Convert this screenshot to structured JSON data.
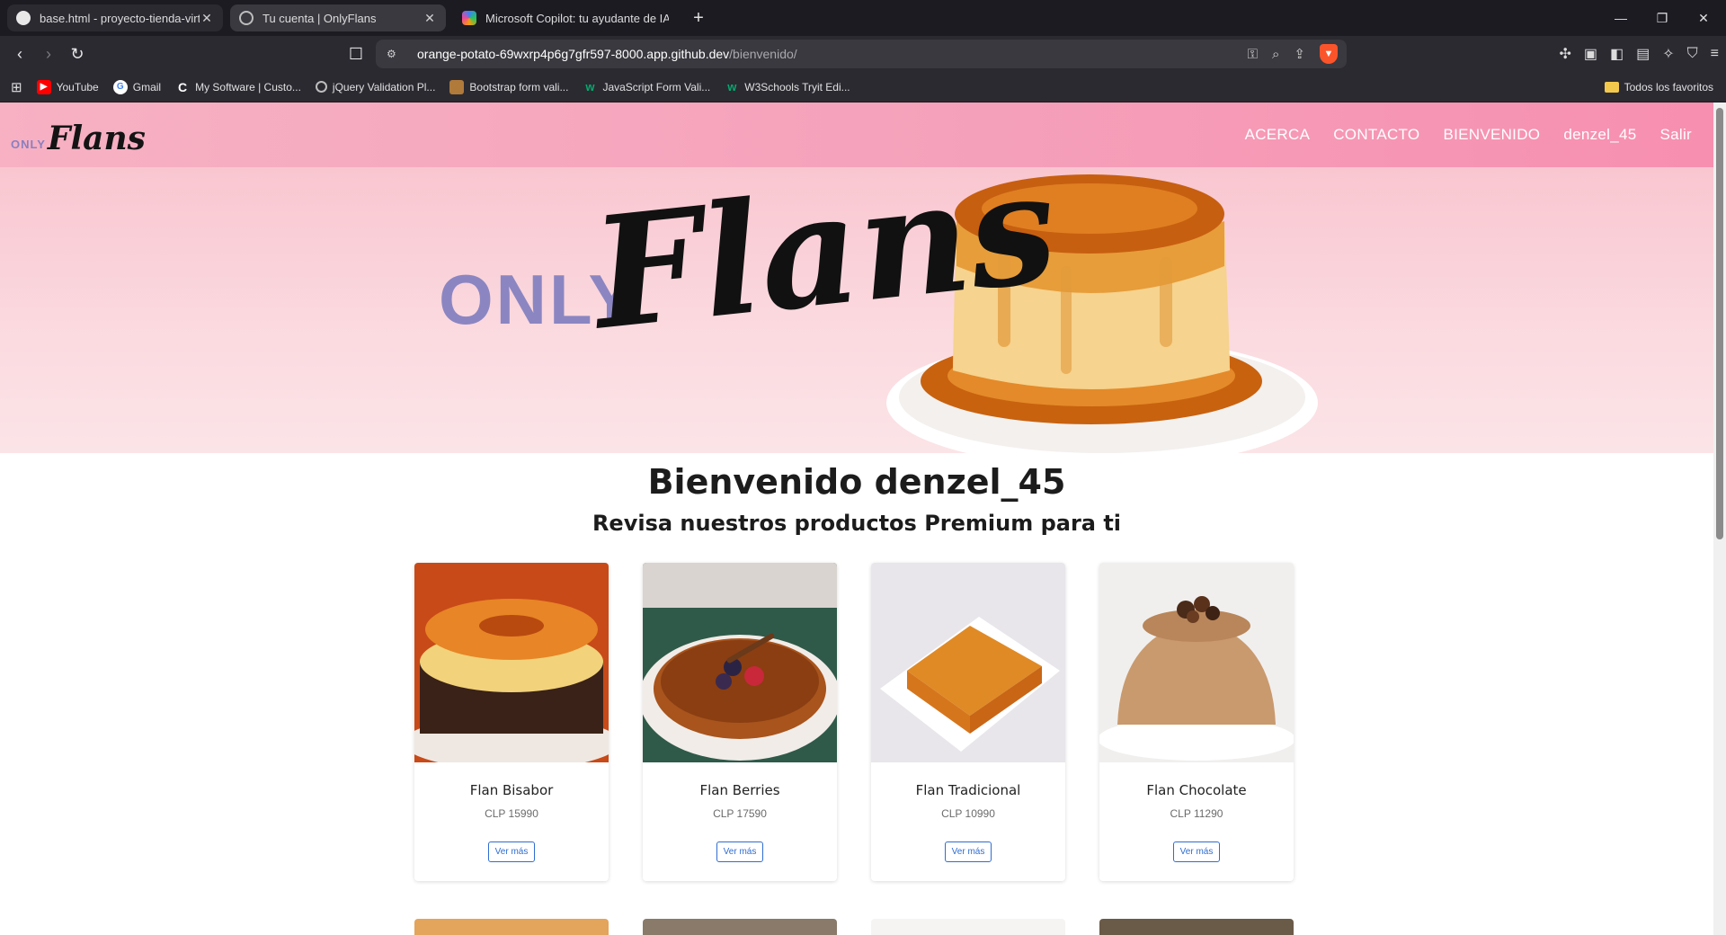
{
  "browser": {
    "tabs": [
      {
        "label": "base.html - proyecto-tienda-virtu",
        "icon": "github-icon",
        "state": "inactive"
      },
      {
        "label": "Tu cuenta | OnlyFlans",
        "icon": "globe-icon",
        "state": "active"
      },
      {
        "label": "Microsoft Copilot: tu ayudante de IA",
        "icon": "copilot-icon",
        "state": "plain"
      }
    ],
    "close_glyph": "✕",
    "newtab_glyph": "+",
    "url_host": "orange-potato-69wxrp4p6g7gfr597-8000.app.github.dev",
    "url_path": "/bienvenido/",
    "bookmarks": [
      {
        "label": "YouTube",
        "icon": "youtube-icon",
        "color": "#ff0000"
      },
      {
        "label": "Gmail",
        "icon": "google-icon",
        "color": "#ffffff"
      },
      {
        "label": "My Software | Custo...",
        "icon": "c-icon",
        "color": "#ffffff"
      },
      {
        "label": "jQuery Validation Pl...",
        "icon": "globe-icon",
        "color": "#cfcfcf"
      },
      {
        "label": "Bootstrap form vali...",
        "icon": "bookmark-favicon-icon",
        "color": "#b07a3a"
      },
      {
        "label": "JavaScript Form Vali...",
        "icon": "w3schools-icon",
        "color": "#04aa6d"
      },
      {
        "label": "W3Schools Tryit Edi...",
        "icon": "w3schools-icon",
        "color": "#04aa6d"
      }
    ],
    "all_bookmarks": "Todos los favoritos"
  },
  "site": {
    "logo_small": "ONLY",
    "logo_script": "Flans",
    "menu": [
      "ACERCA",
      "CONTACTO",
      "BIENVENIDO",
      "denzel_45",
      "Salir"
    ],
    "hero_only": "ONLY",
    "hero_script": "Flans",
    "welcome_title": "Bienvenido denzel_45",
    "welcome_subtitle": "Revisa nuestros productos Premium para ti",
    "products": [
      {
        "name": "Flan Bisabor",
        "price": "CLP 15990",
        "button": "Ver más"
      },
      {
        "name": "Flan Berries",
        "price": "CLP 17590",
        "button": "Ver más"
      },
      {
        "name": "Flan Tradicional",
        "price": "CLP 10990",
        "button": "Ver más"
      },
      {
        "name": "Flan Chocolate",
        "price": "CLP 11290",
        "button": "Ver más"
      }
    ]
  },
  "colors": {
    "header_pink": "#f5a1bb",
    "hero_pink": "#fbd9df",
    "caramel": "#d9821e",
    "link_blue": "#2f6dd0",
    "brave_orange": "#fb542b"
  }
}
